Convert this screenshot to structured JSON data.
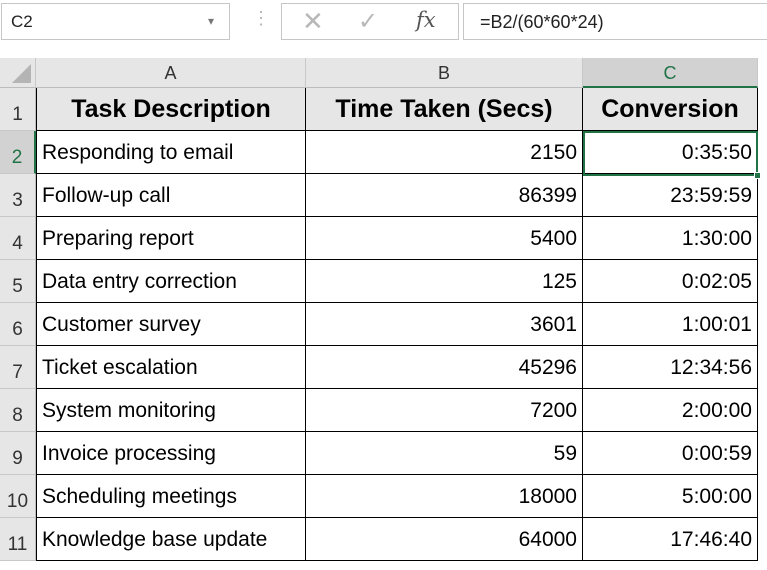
{
  "formula_bar": {
    "name_box": "C2",
    "dropdown_icon": "▾",
    "grip_icon": "⋮",
    "cancel_icon": "✕",
    "enter_icon": "✓",
    "fx_icon": "fx",
    "formula": "=B2/(60*60*24)"
  },
  "sheet": {
    "active_cell": "C2",
    "accent_color": "#217346",
    "column_headers": [
      "A",
      "B",
      "C"
    ],
    "row_headers": [
      "1",
      "2",
      "3",
      "4",
      "5",
      "6",
      "7",
      "8",
      "9",
      "10",
      "11"
    ],
    "table_header": [
      "Task Description",
      "Time Taken (Secs)",
      "Conversion"
    ],
    "rows": [
      [
        "Responding to email",
        "2150",
        "0:35:50"
      ],
      [
        "Follow-up call",
        "86399",
        "23:59:59"
      ],
      [
        "Preparing report",
        "5400",
        "1:30:00"
      ],
      [
        "Data entry correction",
        "125",
        "0:02:05"
      ],
      [
        "Customer survey",
        "3601",
        "1:00:01"
      ],
      [
        "Ticket escalation",
        "45296",
        "12:34:56"
      ],
      [
        "System monitoring",
        "7200",
        "2:00:00"
      ],
      [
        "Invoice processing",
        "59",
        "0:00:59"
      ],
      [
        "Scheduling meetings",
        "18000",
        "5:00:00"
      ],
      [
        "Knowledge base update",
        "64000",
        "17:46:40"
      ]
    ]
  }
}
